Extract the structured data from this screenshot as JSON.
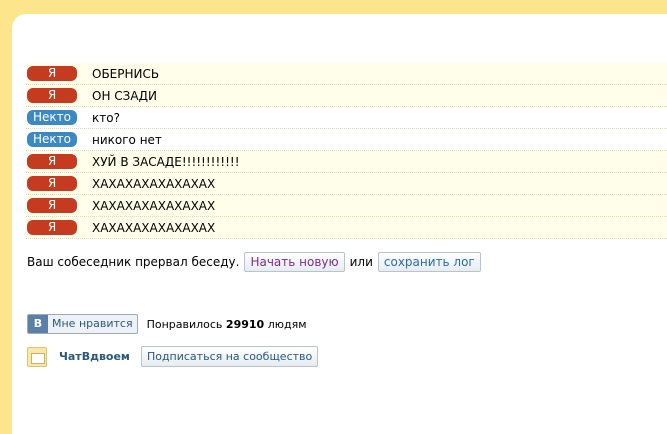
{
  "chat": {
    "messages": [
      {
        "author": "Я",
        "type": "me",
        "text": "ОБЕРНИСЬ"
      },
      {
        "author": "Я",
        "type": "me",
        "text": "ОН СЗАДИ"
      },
      {
        "author": "Некто",
        "type": "peer",
        "text": "кто?"
      },
      {
        "author": "Некто",
        "type": "peer",
        "text": "никого нет"
      },
      {
        "author": "Я",
        "type": "me",
        "text": "ХУЙ В ЗАСАДЕ!!!!!!!!!!!!"
      },
      {
        "author": "Я",
        "type": "me",
        "text": "ХАХАХАХАХАХАХАХ"
      },
      {
        "author": "Я",
        "type": "me",
        "text": "ХАХАХАХАХАХАХАХ"
      },
      {
        "author": "Я",
        "type": "me",
        "text": "ХАХАХАХАХАХАХАХ"
      }
    ],
    "ended_text": "Ваш собеседник прервал беседу.",
    "new_chat_label": "Начать новую",
    "or_text": "или",
    "save_log_label": "сохранить лог"
  },
  "vk": {
    "logo": "В",
    "like_label": "Мне нравится",
    "liked_prefix": "Понравилось",
    "liked_count": "29910",
    "liked_suffix": "людям"
  },
  "community": {
    "name": "ЧатВдвоем",
    "subscribe_label": "Подписаться на сообщество",
    "icon": "community-icon"
  }
}
